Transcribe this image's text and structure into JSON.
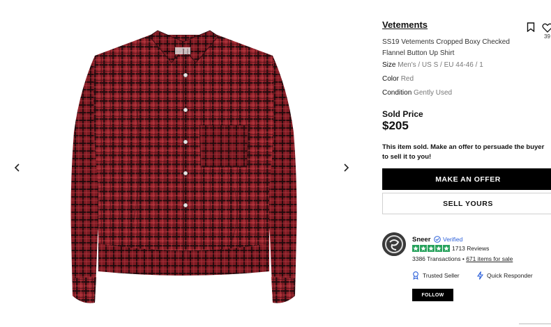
{
  "gallery": {
    "prev_icon": "chevron-left-icon",
    "next_icon": "chevron-right-icon",
    "image_alt": "plaid-shirt-image",
    "shirt_colors": {
      "base": "#8e1f28",
      "dark": "#1f0a0d",
      "light": "#c9434a"
    }
  },
  "listing": {
    "brand": "Vetements",
    "title": "SS19 Vetements Cropped Boxy Checked Flannel Button Up Shirt",
    "save_icon": "bookmark-icon",
    "like_icon": "heart-icon",
    "like_count": "39",
    "size_label": "Size",
    "size_value": "Men's / US S / EU 44-46 / 1",
    "color_label": "Color",
    "color_value": "Red",
    "condition_label": "Condition",
    "condition_value": "Gently Used",
    "sold_label": "Sold Price",
    "sold_price": "$205",
    "sold_note": "This item sold. Make an offer to persuade the buyer to sell it to you!"
  },
  "actions": {
    "make_offer": "MAKE AN OFFER",
    "sell_yours": "SELL YOURS"
  },
  "seller": {
    "name": "Sneer",
    "verified_label": "Verified",
    "rating_stars": 5,
    "reviews": "1713 Reviews",
    "transactions": "3386 Transactions",
    "separator": "•",
    "items_for_sale": "671 items for sale",
    "trusted_label": "Trusted Seller",
    "quick_label": "Quick Responder",
    "follow_label": "FOLLOW",
    "star_color": "#27a25c",
    "verified_color": "#2b5fd9"
  }
}
